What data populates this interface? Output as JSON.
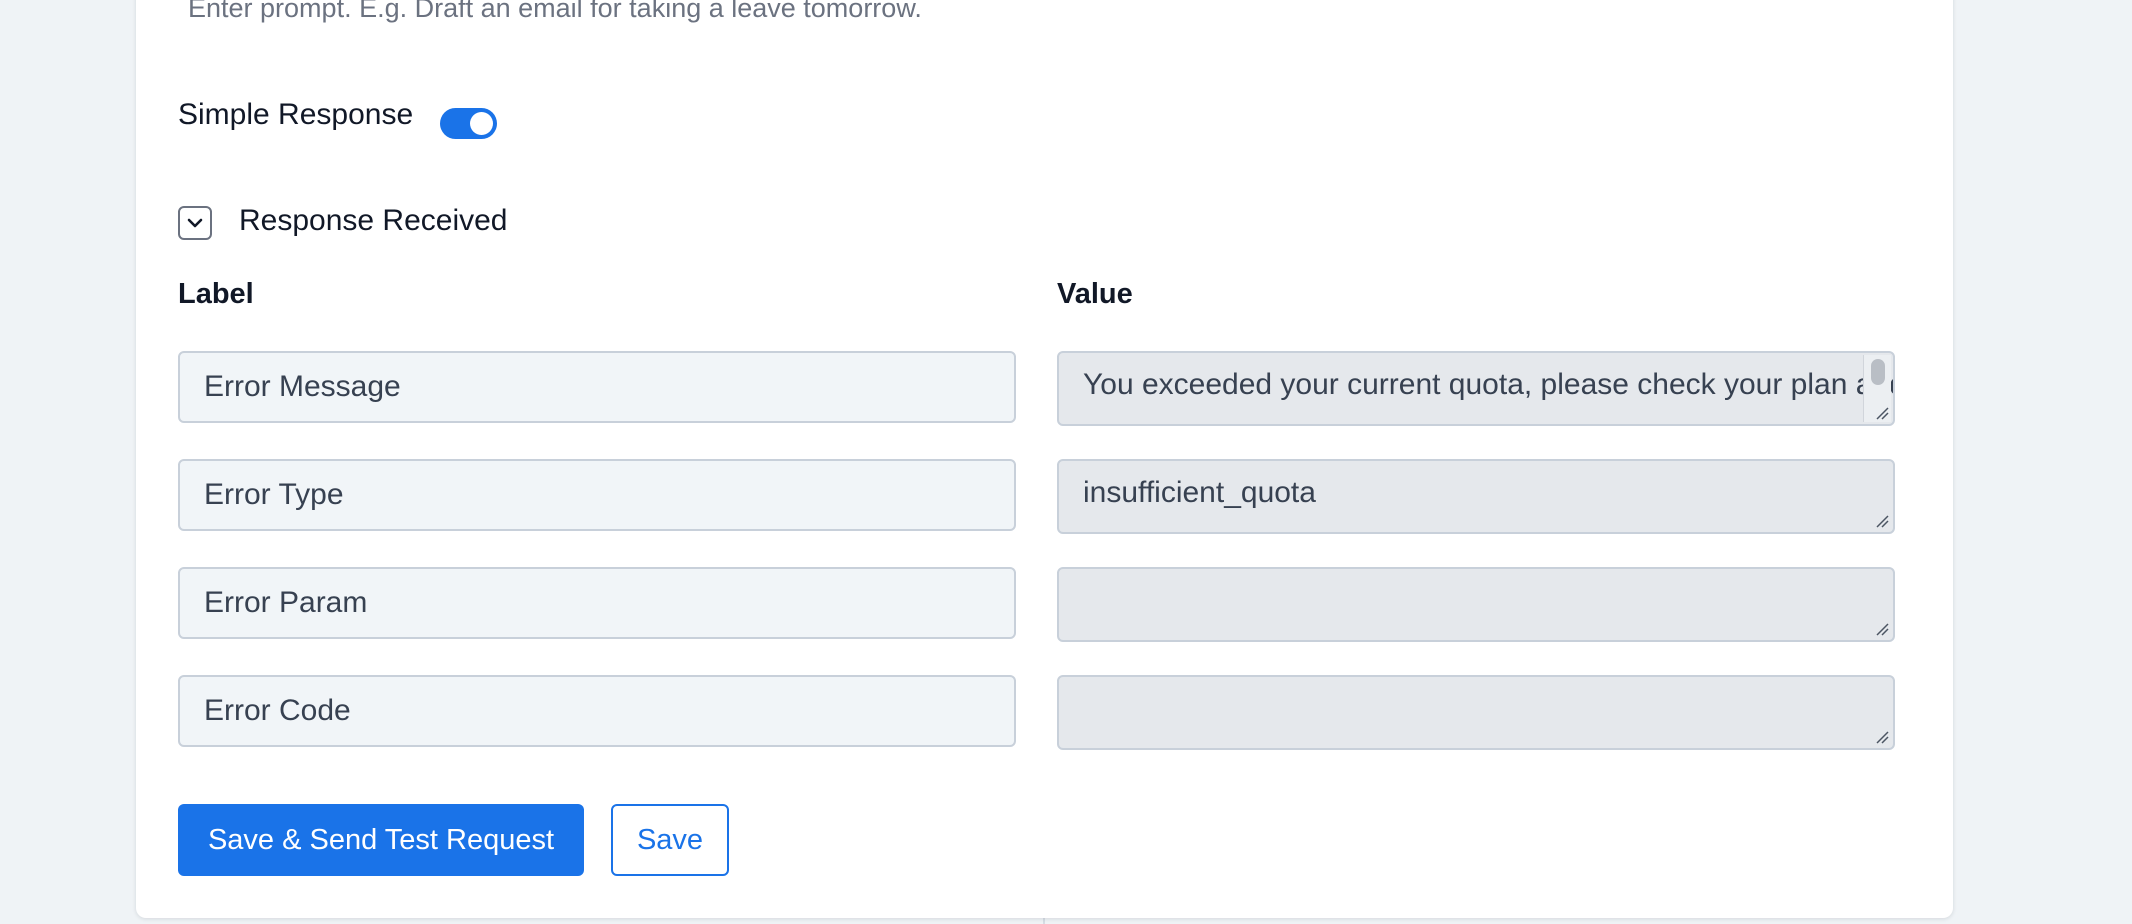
{
  "prompt": {
    "placeholder": "Enter prompt. E.g. Draft an email for taking a leave tomorrow."
  },
  "simple_response": {
    "label": "Simple Response",
    "enabled": true
  },
  "response_section": {
    "title": "Response Received",
    "expanded": true,
    "label_header": "Label",
    "value_header": "Value",
    "rows": [
      {
        "label": "Error Message",
        "value": "You exceeded your current quota, please check your plan and billing details."
      },
      {
        "label": "Error Type",
        "value": "insufficient_quota"
      },
      {
        "label": "Error Param",
        "value": ""
      },
      {
        "label": "Error Code",
        "value": ""
      }
    ]
  },
  "actions": {
    "save_send_label": "Save & Send Test Request",
    "save_label": "Save"
  },
  "colors": {
    "accent": "#1a73e8",
    "background": "#eff3f6",
    "card": "#ffffff"
  },
  "icons": {
    "collapse": "chevron-down-icon"
  }
}
